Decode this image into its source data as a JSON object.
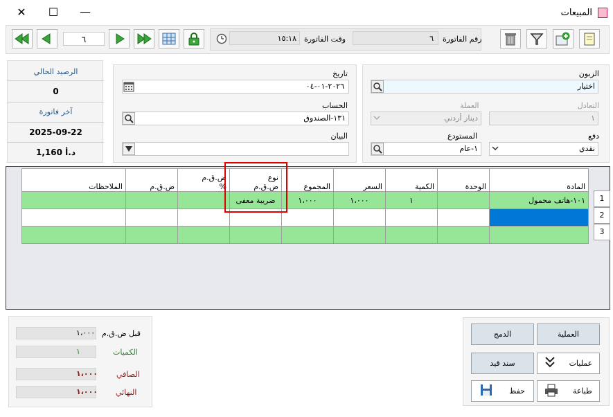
{
  "window": {
    "title": "المبيعات",
    "minimize_glyph": "—",
    "maximize_glyph": "☐",
    "close_glyph": "✕"
  },
  "toolbar": {
    "page_number": "٦",
    "invoice_time_label": "وقت الفاتورة",
    "invoice_time_value": "١٥:١٨",
    "invoice_number_label": "رقم الفاتورة",
    "invoice_number_value": "٦"
  },
  "sidebar": {
    "current_balance_label": "الرصيد الحالي",
    "current_balance_value": "0",
    "last_invoice_label": "آخر فاتورة",
    "last_invoice_date": "2025-09-22",
    "last_invoice_amount": "د.أ 1,160"
  },
  "form_mid": {
    "date_label": "تاريخ",
    "date_value": "٢٠٢٦-٠١-٠٤",
    "account_label": "الحساب",
    "account_value": "١٣١-الصندوق",
    "statement_label": "البيان",
    "statement_value": ""
  },
  "form_right": {
    "customer_label": "الزبون",
    "customer_value": "اختيار",
    "exchange_label": "التعادل",
    "exchange_value": "١",
    "currency_label": "العملة",
    "currency_value": "دينار أردني",
    "payment_label": "دفع",
    "payment_value": "نقدي",
    "warehouse_label": "المستودع",
    "warehouse_value": "١-عام"
  },
  "grid": {
    "headers": {
      "item": "المادة",
      "unit": "الوحدة",
      "qty": "الكمية",
      "price": "السعر",
      "total": "المجموع",
      "tax_type_line1": "نوع",
      "tax_type_line2": "ض.ق.م",
      "tax_pct_line1": "ض.ق.م",
      "tax_pct_line2": "%",
      "tax": "ض.ق.م",
      "notes": "الملاحظات"
    },
    "row1": {
      "num": "1",
      "item": "١٠١-هاتف محمول",
      "unit": "",
      "qty": "١",
      "price": "١،٠٠٠",
      "total": "١،٠٠٠",
      "tax_type": "ضريبة معفى"
    },
    "row2_num": "2",
    "row3_num": "3"
  },
  "summary": {
    "before_tax_label": "قبل ض.ق.م",
    "before_tax_value": "١،٠٠٠",
    "quantities_label": "الكميات",
    "quantities_value": "١",
    "net_label": "الصافي",
    "net_value": "١،٠٠٠",
    "final_label": "النهائي",
    "final_value": "١،٠٠٠"
  },
  "actions": {
    "process_label": "العملية",
    "merge_label": "الدمج",
    "operations_label": "عمليات",
    "journal_label": "سند قيد",
    "print_label": "طباعة",
    "save_label": "حفظ"
  },
  "colors": {
    "green_row": "#97e597",
    "selected_cell": "#0078d7",
    "highlight_box": "#e00000",
    "label_red": "#8b1a1a",
    "label_green": "#2e7d32"
  }
}
